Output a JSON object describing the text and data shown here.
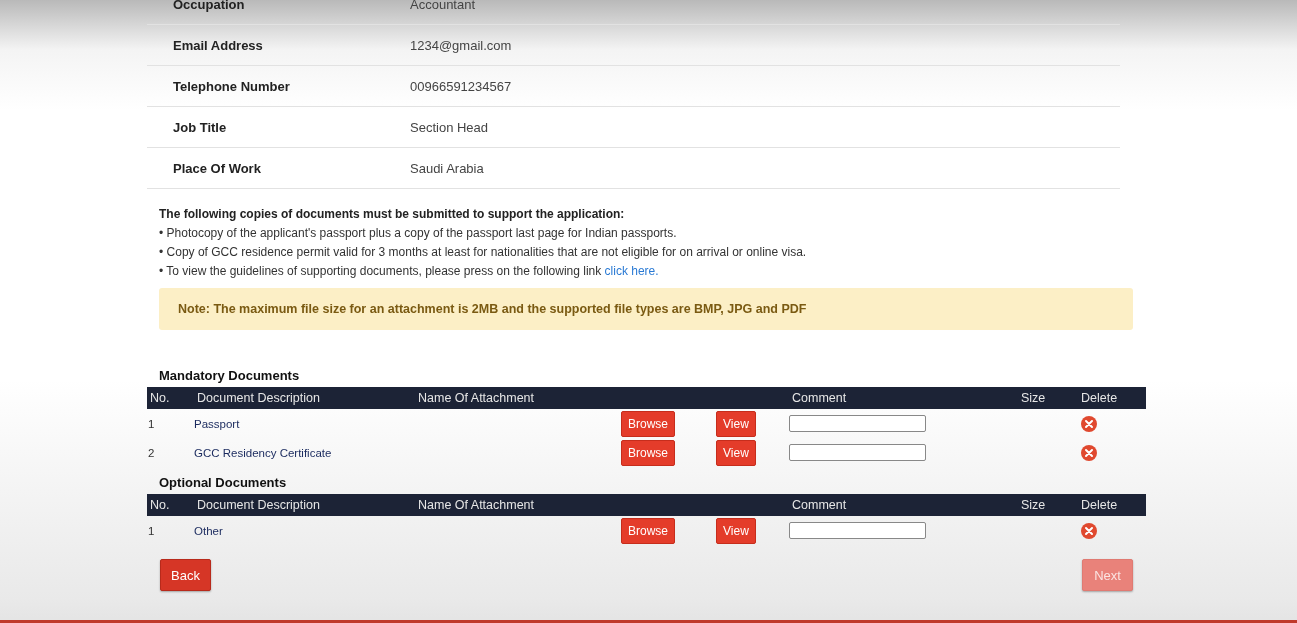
{
  "info_rows": [
    {
      "label": "Occupation",
      "value": "Accountant"
    },
    {
      "label": "Email Address",
      "value": "1234@gmail.com"
    },
    {
      "label": "Telephone Number",
      "value": "00966591234567"
    },
    {
      "label": "Job Title",
      "value": "Section Head"
    },
    {
      "label": "Place Of Work",
      "value": "Saudi Arabia"
    }
  ],
  "requirements": {
    "heading": "The following copies of documents must be submitted to support the application:",
    "items": [
      {
        "text": "• Photocopy of the applicant's passport plus a copy of the passport last page for Indian passports."
      },
      {
        "text": "• Copy of GCC residence permit valid for 3 months at least for nationalities that are not eligible for on arrival or online visa."
      },
      {
        "text": "• To view the guidelines of supporting documents, please press on the following link ",
        "link": "click here."
      }
    ]
  },
  "note": "Note: The maximum file size for an attachment is 2MB and the supported file types are BMP, JPG and PDF",
  "sections": [
    {
      "title": "Mandatory Documents",
      "columns": [
        "No.",
        "Document Description",
        "Name Of Attachment",
        "Comment",
        "Size",
        "Delete"
      ],
      "rows": [
        {
          "no": "1",
          "description": "Passport",
          "browse": "Browse",
          "view": "View"
        },
        {
          "no": "2",
          "description": "GCC Residency Certificate",
          "browse": "Browse",
          "view": "View"
        }
      ]
    },
    {
      "title": "Optional Documents",
      "columns": [
        "No.",
        "Document Description",
        "Name Of Attachment",
        "Comment",
        "Size",
        "Delete"
      ],
      "rows": [
        {
          "no": "1",
          "description": "Other",
          "browse": "Browse",
          "view": "View"
        }
      ]
    }
  ],
  "buttons": {
    "back": {
      "label": "Back",
      "disabled": false
    },
    "next": {
      "label": "Next",
      "disabled": true
    }
  }
}
